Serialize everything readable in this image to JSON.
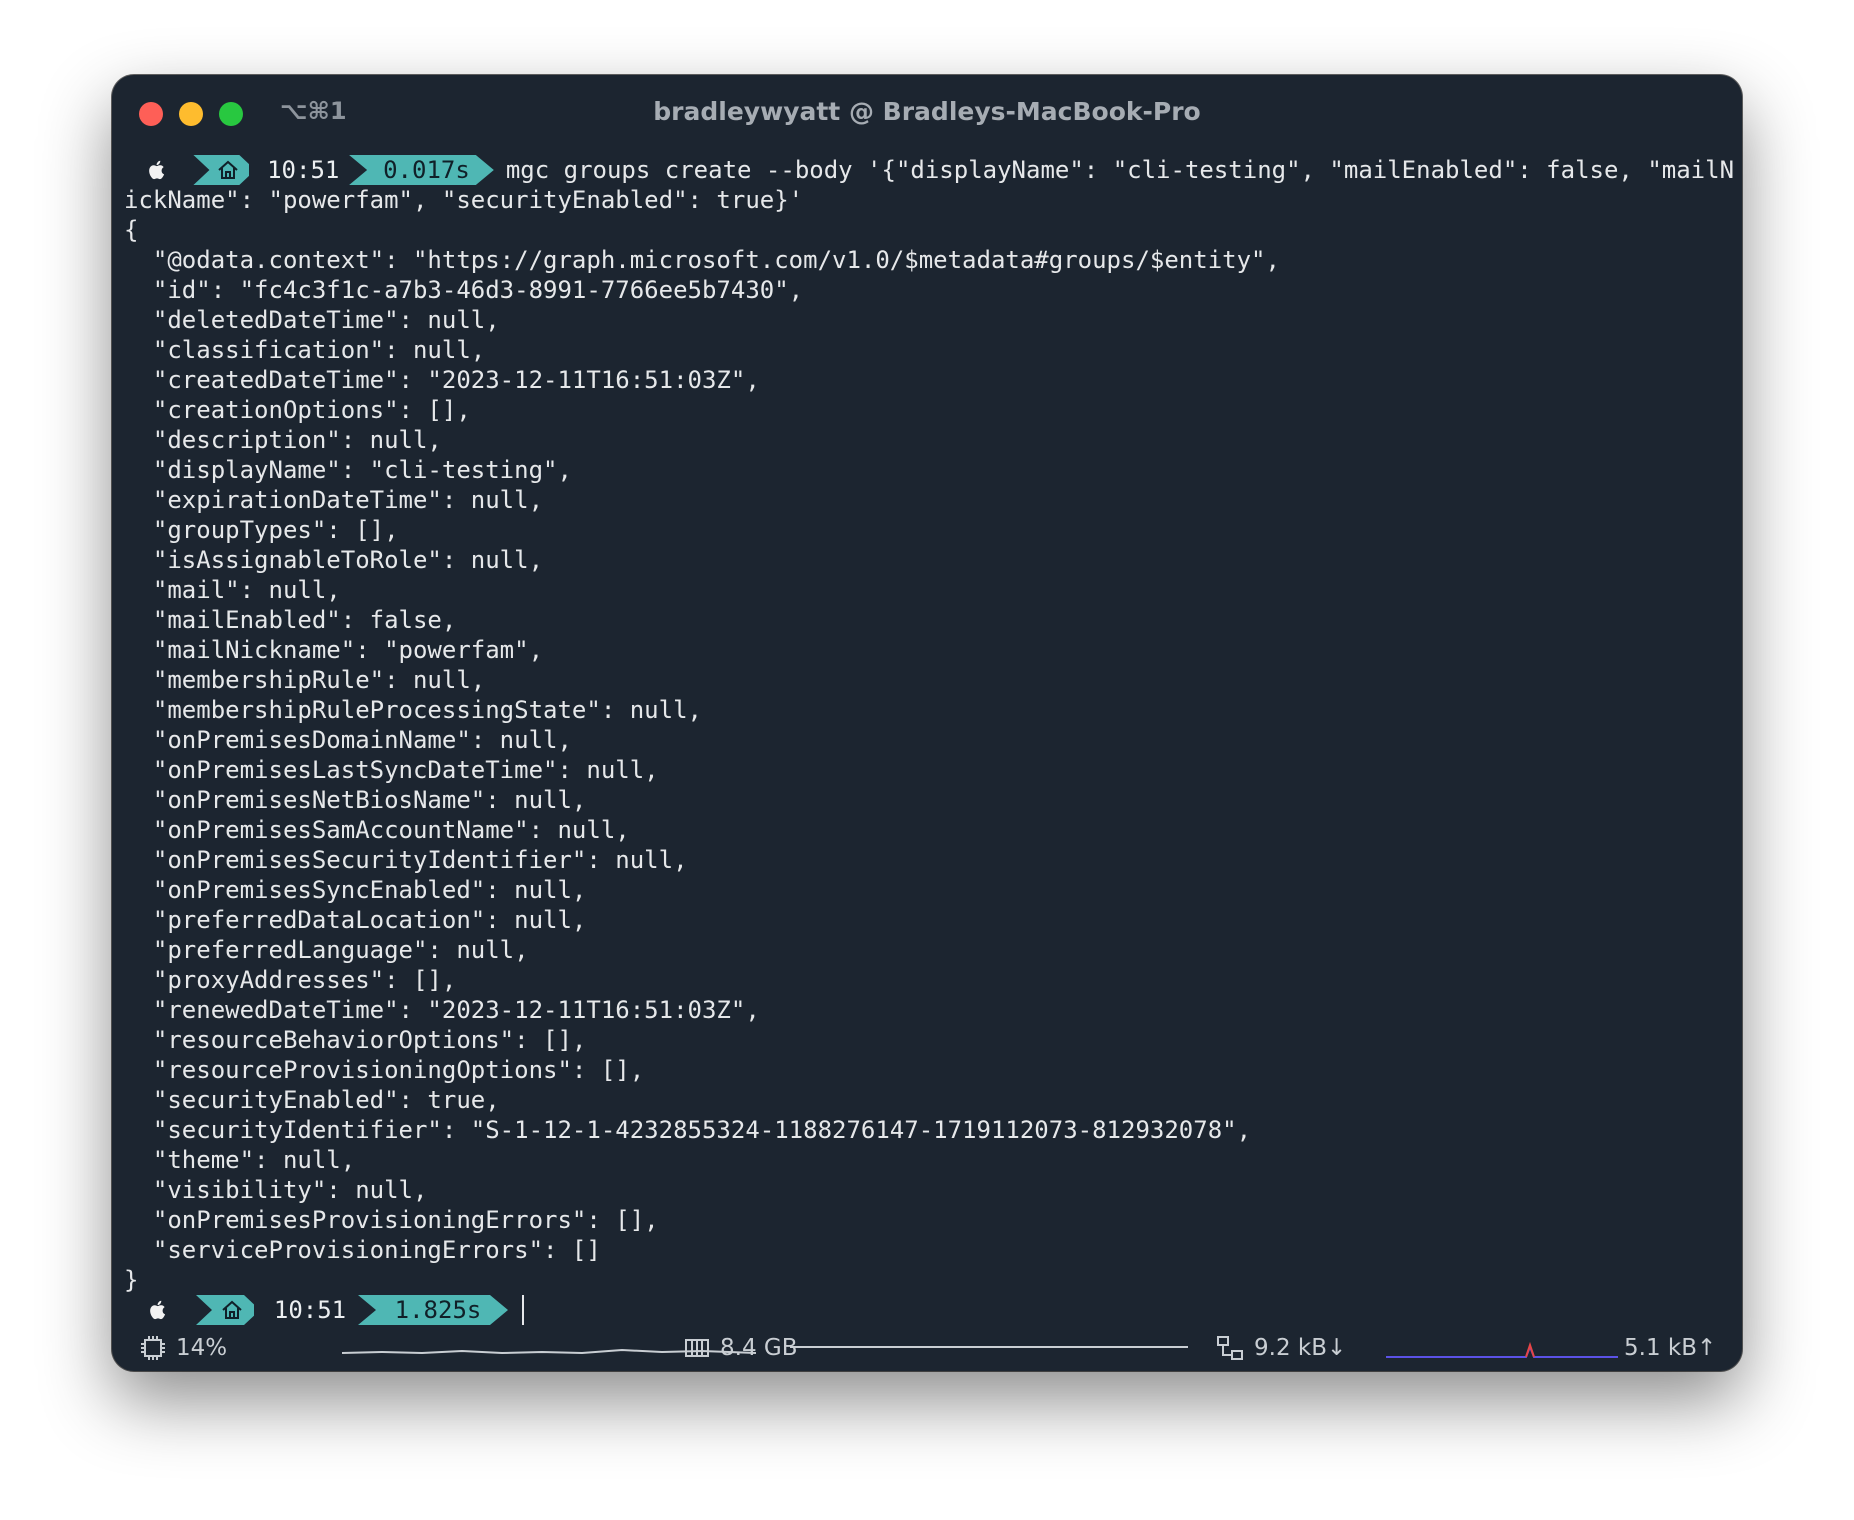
{
  "window": {
    "shortcut": "⌥⌘1",
    "title": "bradleywyatt @ Bradleys-MacBook-Pro"
  },
  "prompt1": {
    "time": "10:51",
    "duration": "0.017s",
    "command_line1": "mgc groups create --body '{\"displayName\": \"cli-testing\", \"mailEnabled\": false, \"mailN",
    "command_line2": "ickName\": \"powerfam\", \"securityEnabled\": true}'"
  },
  "output": [
    "{",
    "  \"@odata.context\": \"https://graph.microsoft.com/v1.0/$metadata#groups/$entity\",",
    "  \"id\": \"fc4c3f1c-a7b3-46d3-8991-7766ee5b7430\",",
    "  \"deletedDateTime\": null,",
    "  \"classification\": null,",
    "  \"createdDateTime\": \"2023-12-11T16:51:03Z\",",
    "  \"creationOptions\": [],",
    "  \"description\": null,",
    "  \"displayName\": \"cli-testing\",",
    "  \"expirationDateTime\": null,",
    "  \"groupTypes\": [],",
    "  \"isAssignableToRole\": null,",
    "  \"mail\": null,",
    "  \"mailEnabled\": false,",
    "  \"mailNickname\": \"powerfam\",",
    "  \"membershipRule\": null,",
    "  \"membershipRuleProcessingState\": null,",
    "  \"onPremisesDomainName\": null,",
    "  \"onPremisesLastSyncDateTime\": null,",
    "  \"onPremisesNetBiosName\": null,",
    "  \"onPremisesSamAccountName\": null,",
    "  \"onPremisesSecurityIdentifier\": null,",
    "  \"onPremisesSyncEnabled\": null,",
    "  \"preferredDataLocation\": null,",
    "  \"preferredLanguage\": null,",
    "  \"proxyAddresses\": [],",
    "  \"renewedDateTime\": \"2023-12-11T16:51:03Z\",",
    "  \"resourceBehaviorOptions\": [],",
    "  \"resourceProvisioningOptions\": [],",
    "  \"securityEnabled\": true,",
    "  \"securityIdentifier\": \"S-1-12-1-4232855324-1188276147-1719112073-812932078\",",
    "  \"theme\": null,",
    "  \"visibility\": null,",
    "  \"onPremisesProvisioningErrors\": [],",
    "  \"serviceProvisioningErrors\": []",
    "}"
  ],
  "prompt2": {
    "time": "10:51",
    "duration": "1.825s"
  },
  "status": {
    "cpu": "14%",
    "memory": "8.4 GB",
    "net_down": "9.2 kB↓",
    "net_up": "5.1 kB↑"
  },
  "icons": {
    "apple": "apple-icon",
    "home": "home-icon",
    "cpu": "cpu-icon",
    "memory": "memory-icon",
    "network": "network-icon"
  },
  "colors": {
    "background": "#1c2530",
    "segment": "#4fb7b4",
    "text": "#e6e8ea"
  }
}
